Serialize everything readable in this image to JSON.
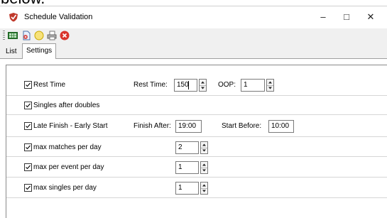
{
  "background": {
    "caption_text": "below."
  },
  "window": {
    "title": "Schedule Validation",
    "controls": [
      "–",
      "□",
      "✕"
    ]
  },
  "toolbar": {
    "icons": [
      "grid-icon",
      "document-icon",
      "circle-icon",
      "print-icon",
      "close-red-icon"
    ]
  },
  "tabs": [
    {
      "label": "List",
      "active": false
    },
    {
      "label": "Settings",
      "active": true
    }
  ],
  "rules": [
    {
      "label": "Rest Time",
      "checked": true,
      "field1_label": "Rest Time:",
      "field1_value": "150",
      "field2_label": "OOP:",
      "field2_value": "1"
    },
    {
      "label": "Singles after doubles",
      "checked": true
    },
    {
      "label": "Late Finish - Early Start",
      "checked": true,
      "field1_label": "Finish After:",
      "field1_value": "19:00",
      "field2_label": "Start Before:",
      "field2_value": "10:00"
    },
    {
      "label": "max matches per day",
      "checked": true,
      "value": "2"
    },
    {
      "label": "max per event per day",
      "checked": true,
      "value": "1"
    },
    {
      "label": "max singles per day",
      "checked": true,
      "value": "1"
    }
  ]
}
